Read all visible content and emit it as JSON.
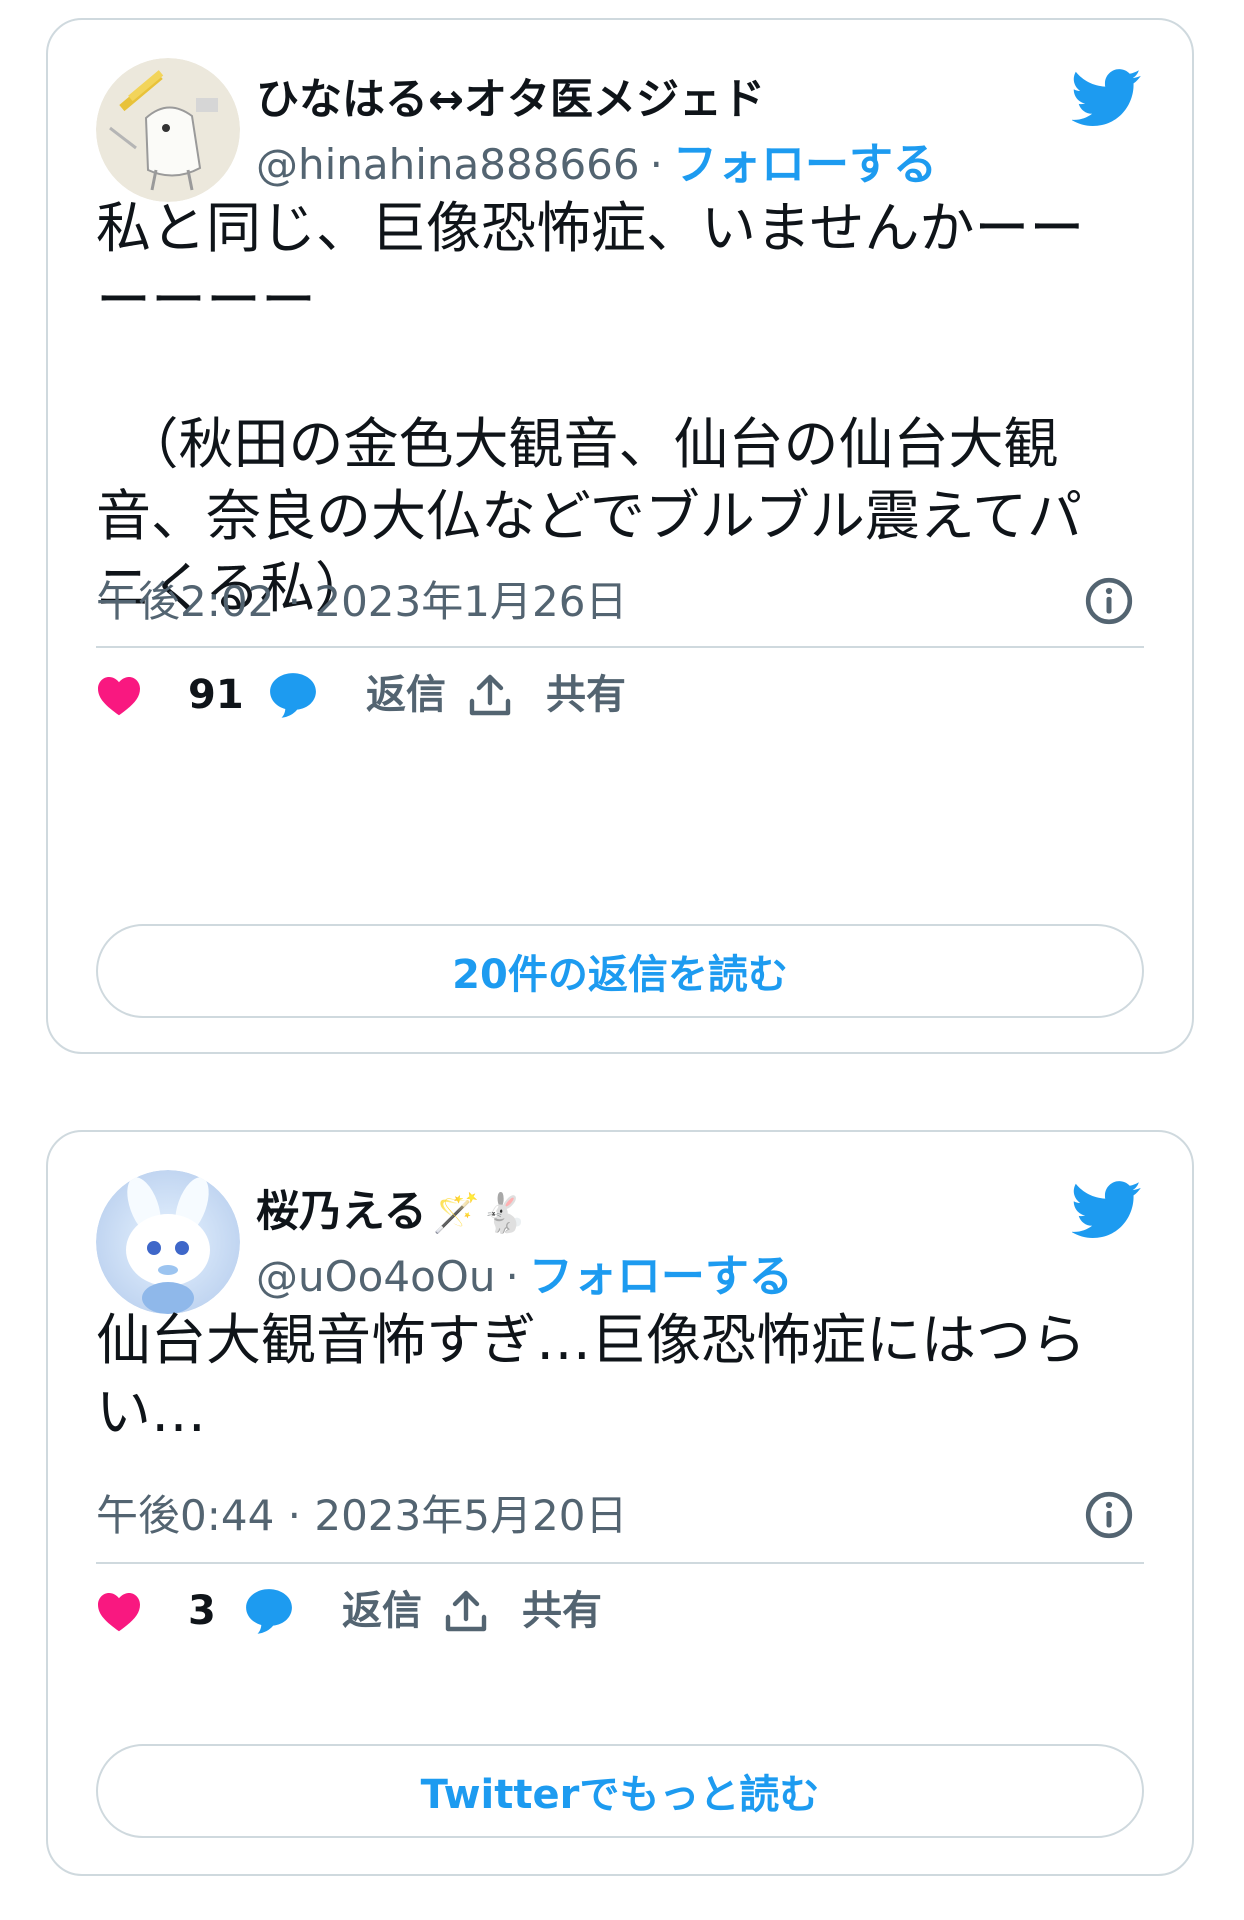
{
  "colors": {
    "accent": "#1d9bf0",
    "like": "#f91880",
    "text": "#0f1419",
    "muted": "#536471",
    "border": "#cfd9de"
  },
  "tweets": [
    {
      "display_name": "ひなはる↔オタ医メジェド",
      "name_emoji": "",
      "handle": "@hinahina888666",
      "separator": "·",
      "follow_label": "フォローする",
      "text": "私と同じ、巨像恐怖症、いませんかーーーーーー\n\n　（秋田の金色大観音、仙台の仙台大観音、奈良の大仏などでブルブル震えてパニくる私）",
      "timestamp": "午後2:02 · 2023年1月26日",
      "likes": "91",
      "reply_label": "返信",
      "share_label": "共有",
      "button_label": "20件の返信を読む",
      "icons": [
        "twitter-bird-icon",
        "info-icon",
        "heart-icon",
        "reply-bubble-icon",
        "share-icon"
      ]
    },
    {
      "display_name": "桜乃える",
      "name_emoji": "🪄🐇",
      "handle": "@uOo4oOu",
      "separator": "·",
      "follow_label": "フォローする",
      "text": "仙台大観音怖すぎ…巨像恐怖症にはつらい…",
      "timestamp": "午後0:44 · 2023年5月20日",
      "likes": "3",
      "reply_label": "返信",
      "share_label": "共有",
      "button_label": "Twitterでもっと読む",
      "icons": [
        "twitter-bird-icon",
        "info-icon",
        "heart-icon",
        "reply-bubble-icon",
        "share-icon"
      ]
    }
  ]
}
